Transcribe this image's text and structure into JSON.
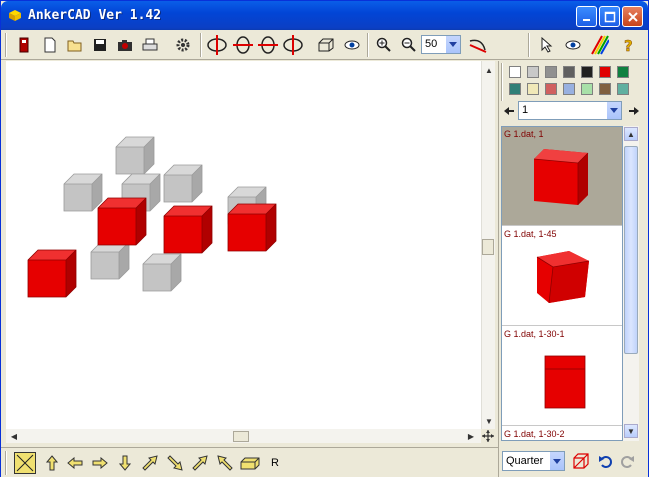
{
  "window": {
    "title": "AnkerCAD Ver 1.42"
  },
  "toolbar": {
    "zoom_value": "50"
  },
  "viewport": {
    "cube_colors": {
      "red": "#e60000",
      "grey": "#c0c0c0"
    }
  },
  "bottom_toolbar": {
    "rotate_label": "R"
  },
  "right_panel": {
    "palette": [
      "#ffffff",
      "#c8c8c8",
      "#909090",
      "#606060",
      "#202020",
      "#e00000",
      "#108040",
      "#308078",
      "#f0e8b8",
      "#d06060",
      "#98b0e0",
      "#a8e0a8",
      "#806040",
      "#60b0a0",
      "#30f0f0"
    ],
    "model_select": "1",
    "parts": [
      {
        "label": "G 1.dat, 1"
      },
      {
        "label": "G 1.dat, 1-45"
      },
      {
        "label": "G 1.dat, 1-30-1"
      },
      {
        "label": "G 1.dat, 1-30-2"
      }
    ],
    "view_select": "Quarter"
  }
}
